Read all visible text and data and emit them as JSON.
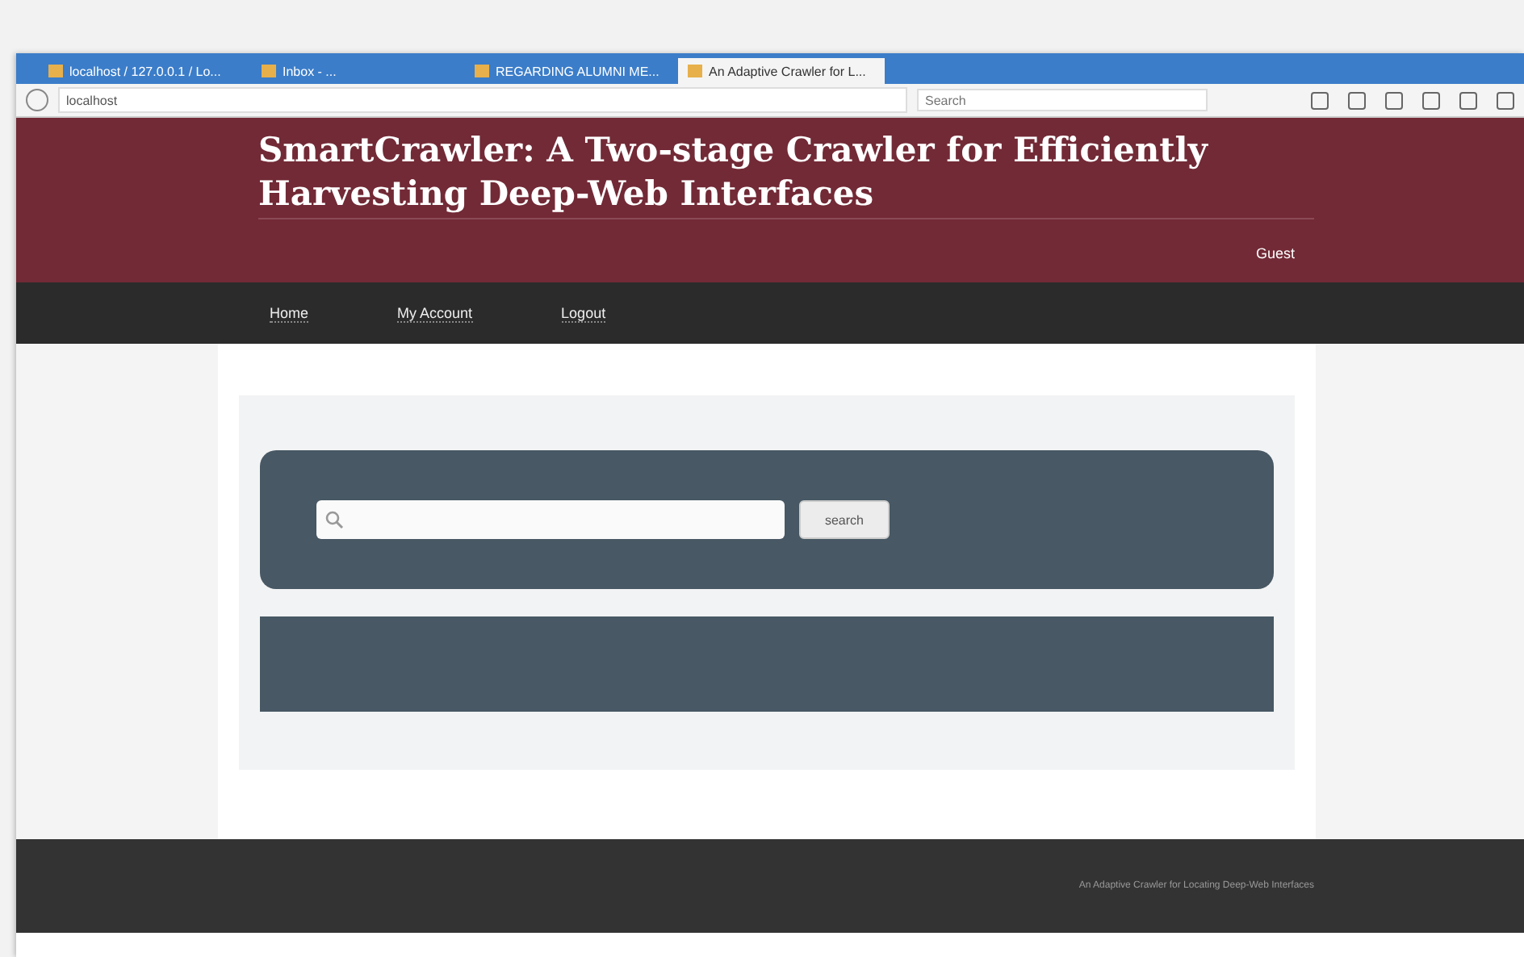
{
  "browser": {
    "tabs": [
      {
        "title": "localhost / 127.0.0.1 / Lo...",
        "selected": false
      },
      {
        "title": "Inbox - ...",
        "selected": false
      },
      {
        "title": "REGARDING ALUMNI ME...",
        "selected": false
      },
      {
        "title": "An Adaptive Crawler for L...",
        "selected": true
      }
    ],
    "address": "localhost",
    "search_placeholder": "Search"
  },
  "header": {
    "title": "SmartCrawler: A Two-stage Crawler for Efficiently Harvesting Deep-Web Interfaces",
    "user": "Guest"
  },
  "nav": [
    "Home",
    "My Account",
    "Logout"
  ],
  "search": {
    "button": "search"
  },
  "footer": "An Adaptive Crawler for Locating Deep-Web Interfaces"
}
